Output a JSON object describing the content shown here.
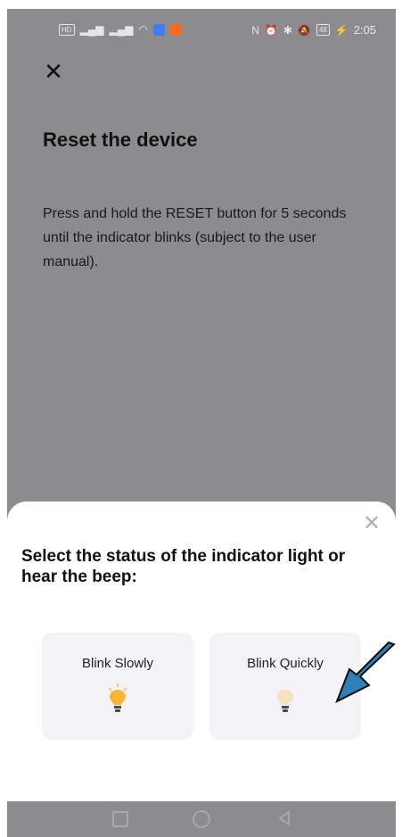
{
  "status_bar": {
    "time": "2:05",
    "battery": "48"
  },
  "page": {
    "title": "Reset the device",
    "description": "Press and hold the RESET button for 5 seconds until the indicator blinks (subject to the user manual)."
  },
  "sheet": {
    "title": "Select the status of the indicator light or hear the beep:",
    "options": [
      {
        "label": "Blink Slowly"
      },
      {
        "label": "Blink Quickly"
      }
    ]
  },
  "colors": {
    "overlay": "#8c8c8f",
    "sheet_bg": "#ffffff",
    "option_bg": "#f3f3f7",
    "arrow": "#2f7fb8"
  },
  "icons": [
    "close-icon",
    "lightbulb-icon",
    "square-nav-icon",
    "circle-nav-icon",
    "back-nav-icon",
    "arrow-annotation"
  ]
}
